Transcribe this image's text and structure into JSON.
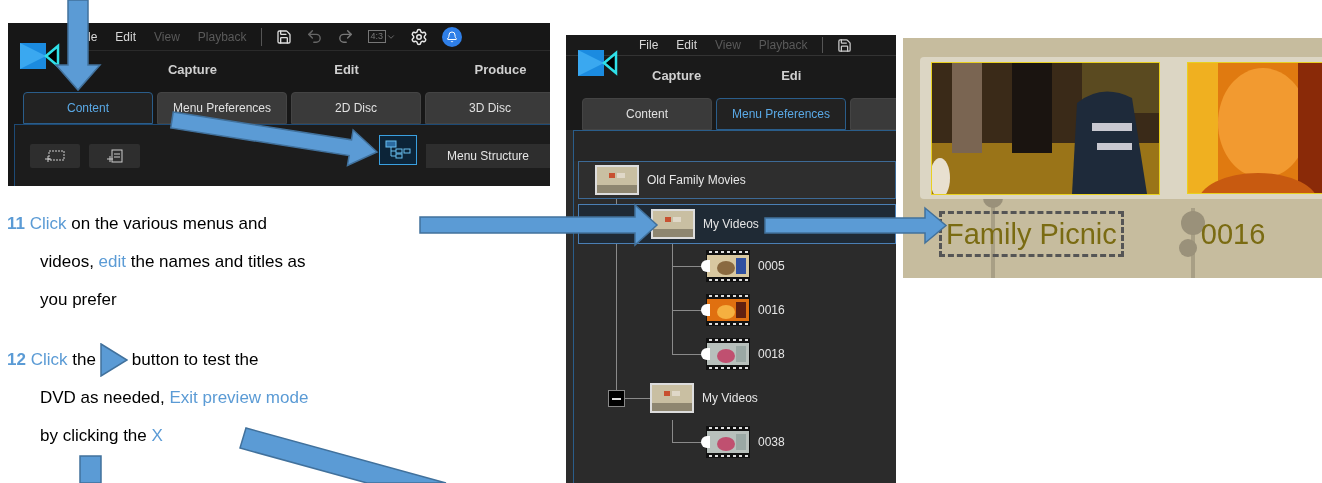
{
  "screenshot_top": {
    "menu": [
      {
        "label": "le",
        "disabled": false
      },
      {
        "label": "Edit",
        "disabled": false
      },
      {
        "label": "View",
        "disabled": true
      },
      {
        "label": "Playback",
        "disabled": true
      }
    ],
    "aspect_ratio": "4:3",
    "modes": [
      "Capture",
      "Edit",
      "Produce"
    ],
    "tabs": [
      {
        "label": "Content",
        "selected": true
      },
      {
        "label": "Menu Preferences",
        "selected": false
      },
      {
        "label": "2D Disc",
        "selected": false
      },
      {
        "label": "3D Disc",
        "selected": false
      }
    ],
    "menu_structure_button": "Menu Structure"
  },
  "steps": [
    {
      "lines": [
        [
          {
            "kind": "number",
            "text": "11 "
          },
          {
            "kind": "highlight",
            "text": "Click"
          },
          {
            "kind": "plain",
            "text": " on the various menus and"
          }
        ],
        [
          {
            "kind": "plain",
            "text": "videos, "
          },
          {
            "kind": "highlight",
            "text": "edit"
          },
          {
            "kind": "plain",
            "text": " the names and titles as"
          }
        ],
        [
          {
            "kind": "plain",
            "text": "you prefer"
          }
        ]
      ]
    },
    {
      "lines": [
        [
          {
            "kind": "number",
            "text": "12 "
          },
          {
            "kind": "highlight",
            "text": "Click"
          },
          {
            "kind": "plain",
            "text": " the"
          },
          {
            "kind": "icon"
          },
          {
            "kind": "plain",
            "text": "button to test the"
          }
        ],
        [
          {
            "kind": "plain",
            "text": "DVD as needed, "
          },
          {
            "kind": "highlight",
            "text": "Exit preview mode"
          }
        ],
        [
          {
            "kind": "plain",
            "text": "by clicking the "
          },
          {
            "kind": "highlight",
            "text": "X"
          }
        ]
      ]
    }
  ],
  "screenshot_tree": {
    "menu": [
      {
        "label": "File",
        "disabled": false
      },
      {
        "label": "Edit",
        "disabled": false
      },
      {
        "label": "View",
        "disabled": true
      },
      {
        "label": "Playback",
        "disabled": true
      }
    ],
    "modes": [
      "Capture",
      "Edi"
    ],
    "tabs": [
      {
        "label": "Content",
        "selected": false
      },
      {
        "label": "Menu Preferences",
        "selected": true
      }
    ],
    "tree": {
      "label": "Old Family Movies",
      "kind": "menu",
      "selected": false,
      "children": [
        {
          "label": "My Videos",
          "kind": "menu",
          "selected": true,
          "children": [
            {
              "label": "0005",
              "kind": "video",
              "selected": false
            },
            {
              "label": "0016",
              "kind": "video",
              "selected": false
            },
            {
              "label": "0018",
              "kind": "video",
              "selected": false
            }
          ]
        },
        {
          "label": "My Videos",
          "kind": "menu",
          "selected": false,
          "expanded": true,
          "children": [
            {
              "label": "0038",
              "kind": "video",
              "selected": false
            }
          ]
        }
      ]
    }
  },
  "preview": {
    "titles": [
      {
        "text": "Family Picnic",
        "selected": true
      },
      {
        "text": "0016",
        "selected": false
      }
    ]
  }
}
